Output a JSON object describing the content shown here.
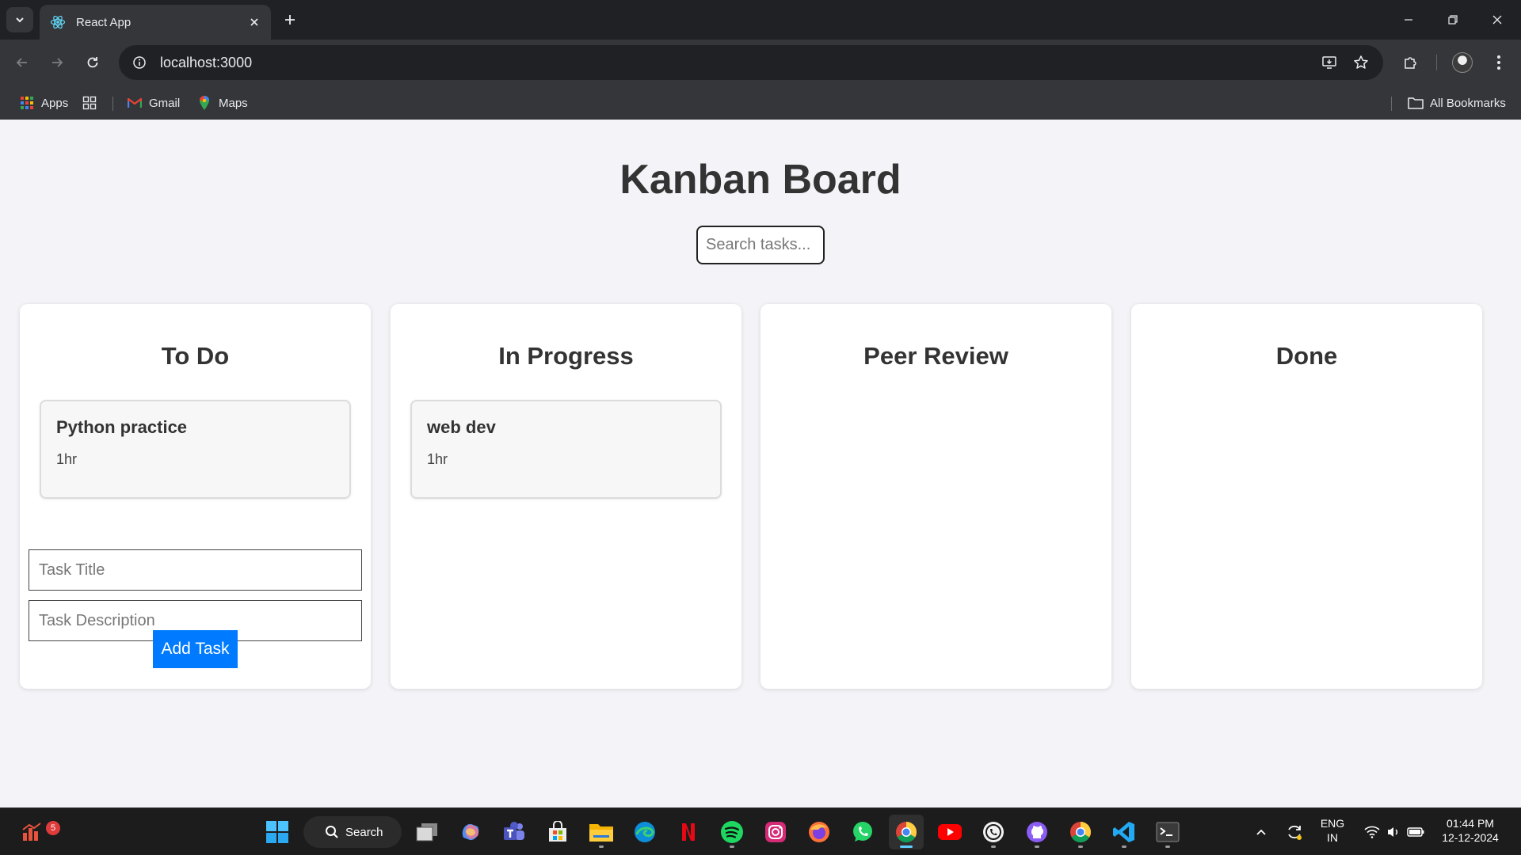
{
  "browser": {
    "tab_title": "React App",
    "url": "localhost:3000",
    "bookmarks": [
      {
        "label": "Apps",
        "icon": "apps-grid-icon"
      },
      {
        "label": "",
        "icon": "tab-groups-icon"
      },
      {
        "label": "Gmail",
        "icon": "gmail-icon"
      },
      {
        "label": "Maps",
        "icon": "maps-icon"
      }
    ],
    "all_bookmarks": "All Bookmarks"
  },
  "page": {
    "title": "Kanban Board",
    "search_placeholder": "Search tasks...",
    "columns": [
      {
        "title": "To Do",
        "tasks": [
          {
            "title": "Python practice",
            "description": "1hr"
          }
        ]
      },
      {
        "title": "In Progress",
        "tasks": [
          {
            "title": "web dev",
            "description": "1hr"
          }
        ]
      },
      {
        "title": "Peer Review",
        "tasks": []
      },
      {
        "title": "Done",
        "tasks": []
      }
    ],
    "form": {
      "title_placeholder": "Task Title",
      "description_placeholder": "Task Description",
      "add_label": "Add Task"
    }
  },
  "taskbar": {
    "search_label": "Search",
    "notification_count": "5",
    "language": "ENG",
    "region": "IN",
    "time": "01:44 PM",
    "date": "12-12-2024",
    "colors": {
      "accent": "#007bff",
      "active_indicator": "#60cdff"
    }
  }
}
